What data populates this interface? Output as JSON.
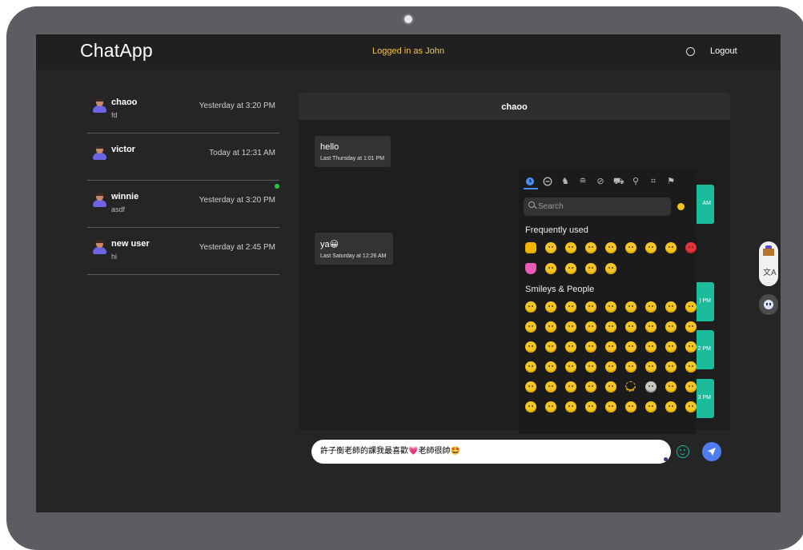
{
  "navbar": {
    "brand": "ChatApp",
    "logged_in_text": "Logged in as John",
    "chat_icon": "chat-bubble-icon",
    "logout_label": "Logout"
  },
  "conversations": [
    {
      "name": "chaoo",
      "preview": "fd",
      "time": "Yesterday at 3:20 PM",
      "online": false
    },
    {
      "name": "victor",
      "preview": "",
      "time": "Today at 12:31 AM",
      "online": false
    },
    {
      "name": "winnie",
      "preview": "asdf",
      "time": "Yesterday at 3:20 PM",
      "online": true
    },
    {
      "name": "new user",
      "preview": "hi",
      "time": "Yesterday at 2:45 PM",
      "online": false
    }
  ],
  "chat": {
    "title": "chaoo",
    "received": [
      {
        "text": "hello",
        "time": "Last Thursday at 1:01 PM"
      },
      {
        "text": "ya😀",
        "time": "Last Saturday at 12:26 AM"
      }
    ],
    "sent_time_fragments": [
      "AM",
      ") PM",
      "2 PM",
      "3 PM"
    ],
    "input_value": "許子衡老師的課我最喜歡💗老師很帥🤩"
  },
  "emoji_picker": {
    "categories": [
      "clock-icon",
      "smiley-icon",
      "animal-icon",
      "food-icon",
      "sport-icon",
      "car-icon",
      "lightbulb-icon",
      "symbols-icon",
      "flag-icon"
    ],
    "search_placeholder": "Search",
    "frequently_used_label": "Frequently used",
    "smileys_label": "Smileys & People"
  },
  "colors": {
    "accent_teal": "#1abc9c",
    "send_blue": "#4f7cf0",
    "logged_in_yellow": "#f4c542",
    "online_green": "#28c840",
    "picker_tab_blue": "#4a8ff7"
  }
}
